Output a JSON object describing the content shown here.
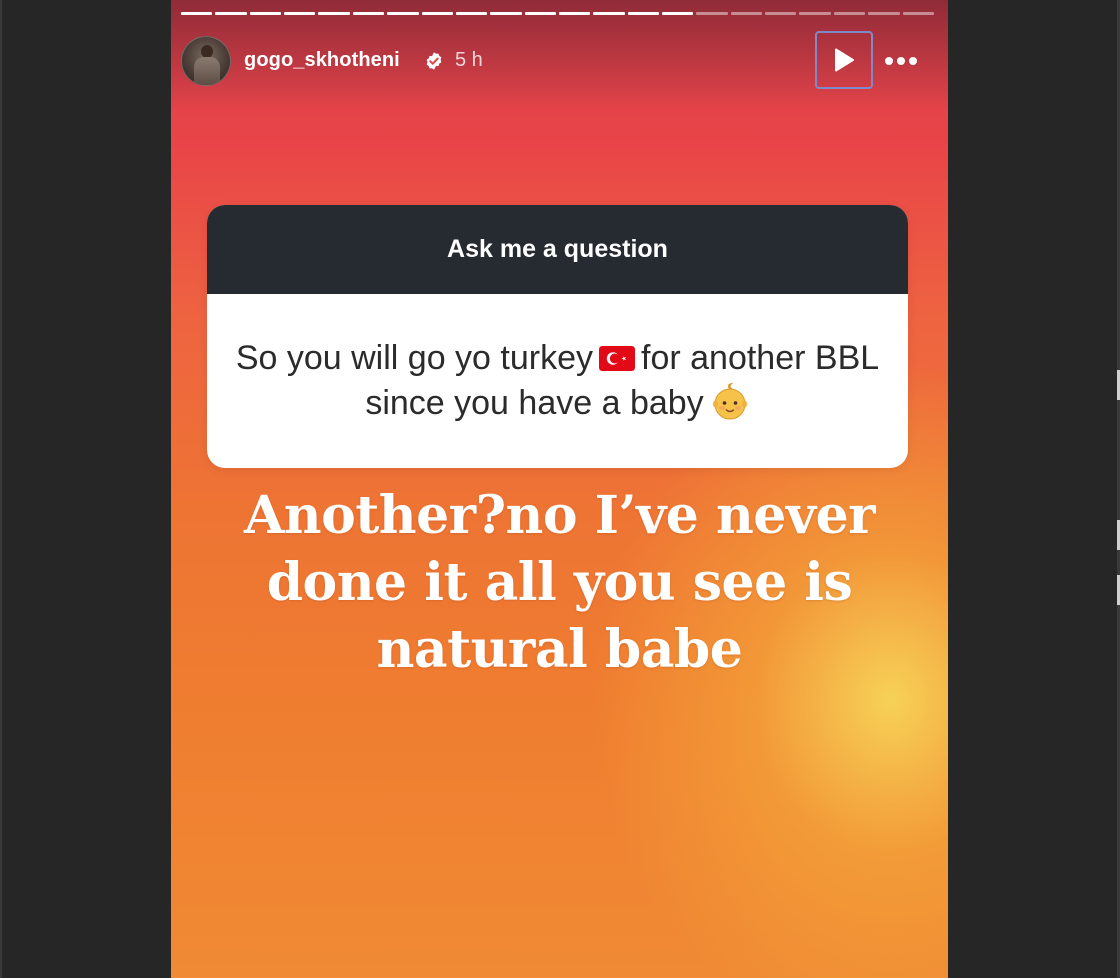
{
  "story": {
    "progress_total": 22,
    "progress_done": 15,
    "user": {
      "username": "gogo_skhotheni",
      "verified": true,
      "time_ago": "5 h"
    },
    "controls": {
      "play_icon": "play-icon",
      "more_icon": "more-dots-icon"
    },
    "question_sticker": {
      "header": "Ask me a question",
      "question_part1": "So you will go yo turkey",
      "flag_emoji": "turkey-flag-icon",
      "question_part2": "for another BBL since you have a baby",
      "baby_emoji": "baby-face-icon"
    },
    "answer_text": "Another?no I’ve never done it all you see is natural babe"
  },
  "colors": {
    "background": "#262626",
    "card_header": "#262a31",
    "selection_outline": "#7f88c8"
  }
}
